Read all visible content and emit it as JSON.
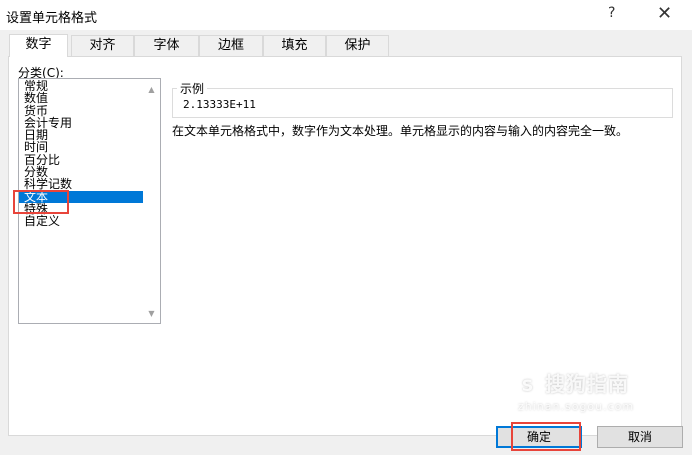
{
  "window": {
    "title": "设置单元格格式",
    "help_label": "?",
    "close_label": "✕"
  },
  "tabs": [
    {
      "label": "数字",
      "active": true
    },
    {
      "label": "对齐",
      "active": false
    },
    {
      "label": "字体",
      "active": false
    },
    {
      "label": "边框",
      "active": false
    },
    {
      "label": "填充",
      "active": false
    },
    {
      "label": "保护",
      "active": false
    }
  ],
  "category": {
    "label_prefix": "分类(",
    "label_key": "C",
    "label_suffix": "):",
    "items": [
      "常规",
      "数值",
      "货币",
      "会计专用",
      "日期",
      "时间",
      "百分比",
      "分数",
      "科学记数",
      "文本",
      "特殊",
      "自定义"
    ],
    "selected": "文本"
  },
  "sample": {
    "legend": "示例",
    "value": "2.13333E+11"
  },
  "description": "在文本单元格格式中，数字作为文本处理。单元格显示的内容与输入的内容完全一致。",
  "buttons": {
    "ok_label": "确定",
    "cancel_label": "取消"
  },
  "watermark": {
    "brand": "搜狗指南",
    "url": "zhinan.sogou.com"
  },
  "colors": {
    "selection": "#0078d7",
    "highlight_box": "#e8443a",
    "default_button_border": "#0078d7"
  },
  "icons": {
    "scroll_up": "chevron-up-icon",
    "scroll_down": "chevron-down-icon"
  }
}
